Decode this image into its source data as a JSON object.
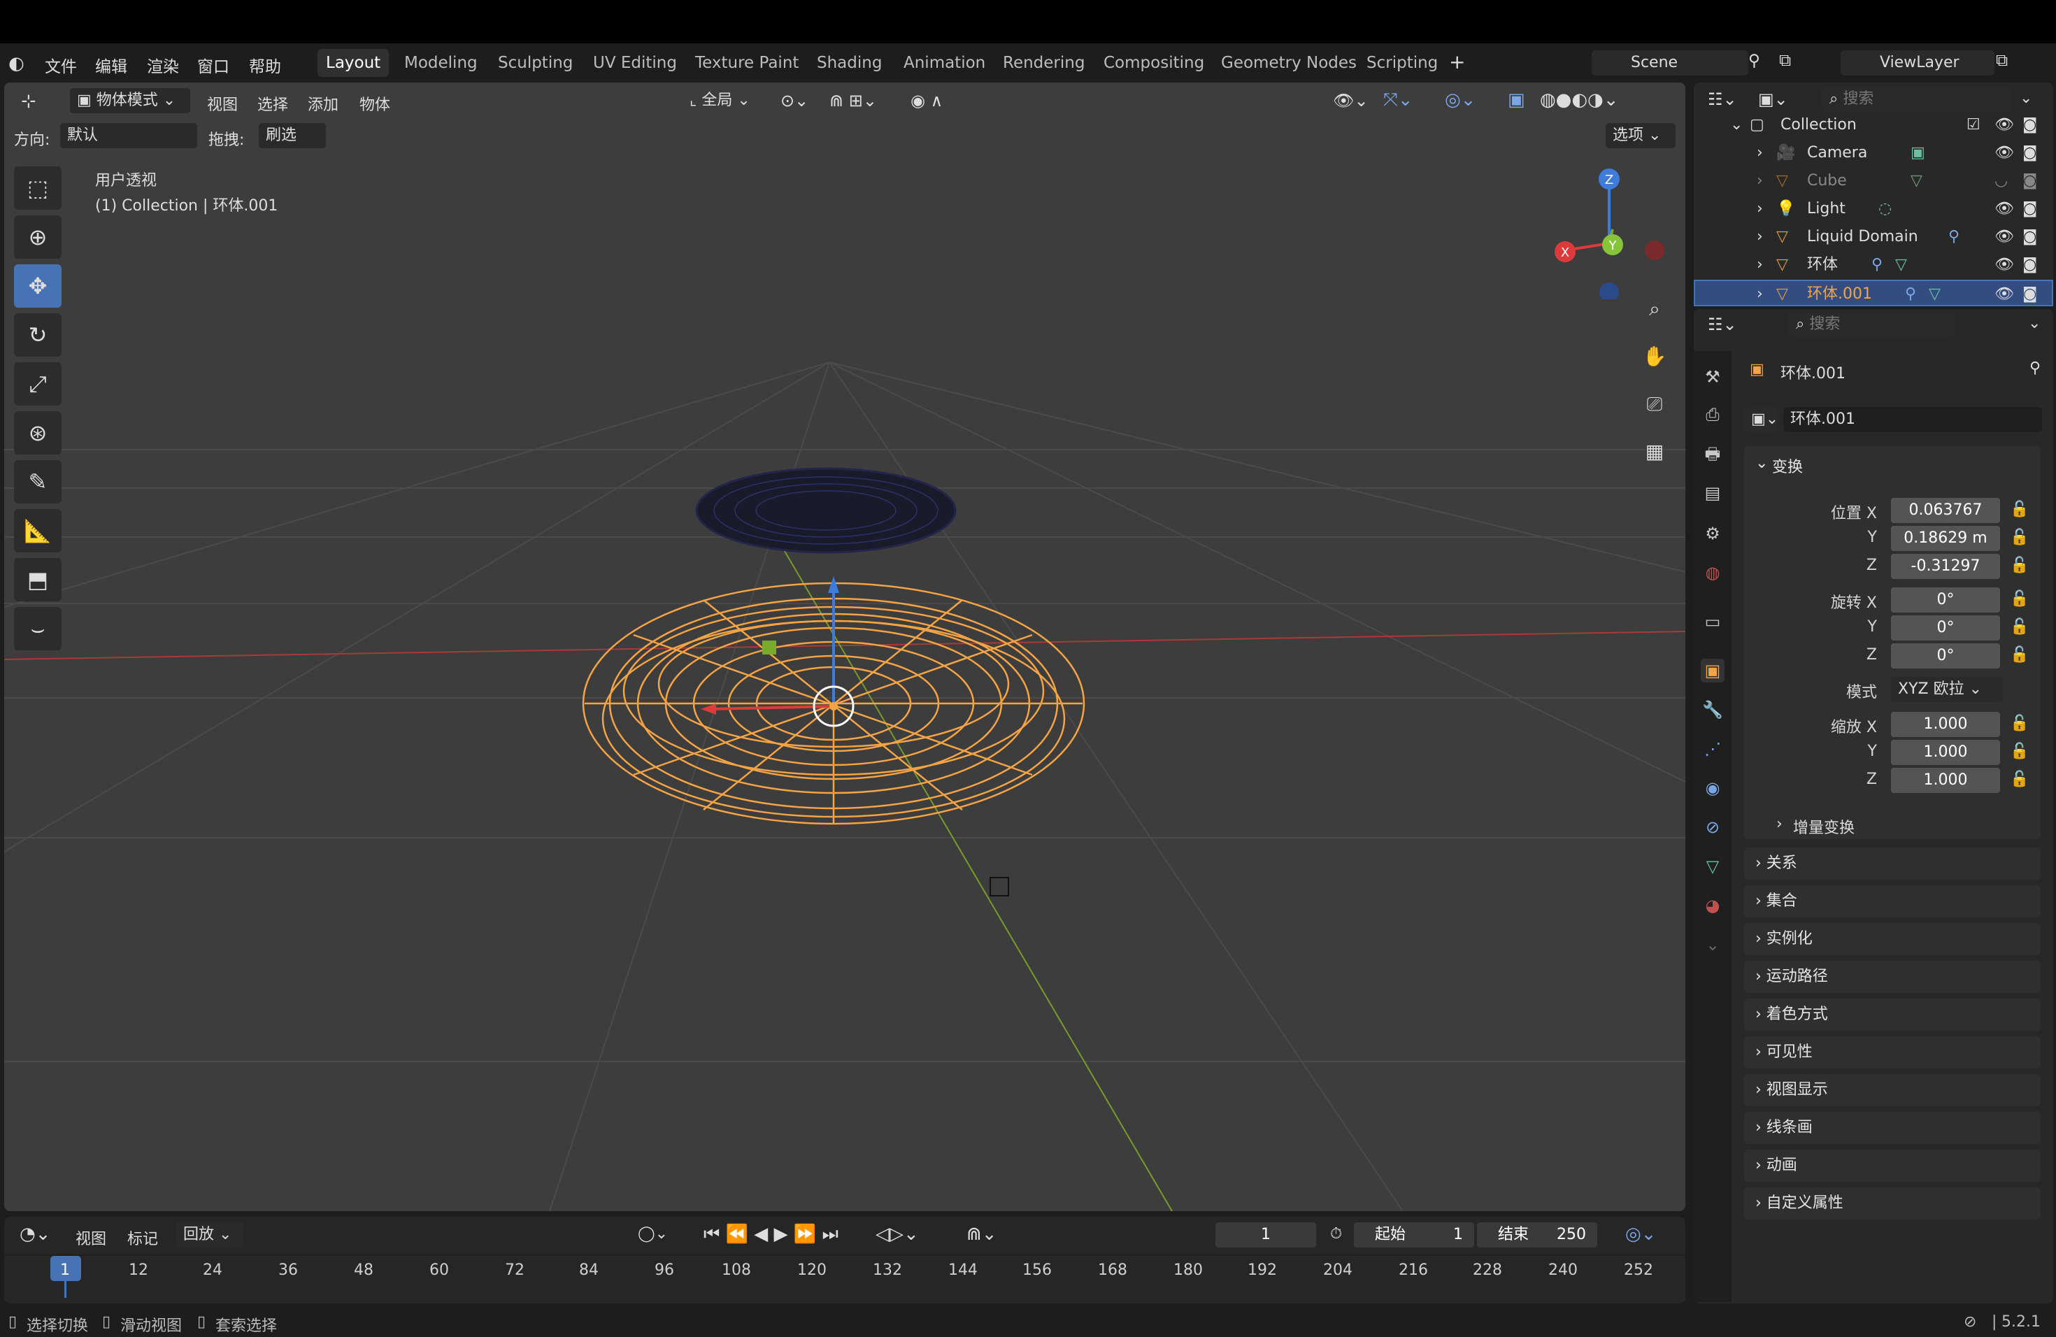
{
  "menu": {
    "items": [
      "文件",
      "编辑",
      "渲染",
      "窗口",
      "帮助"
    ]
  },
  "workspaces": [
    "Layout",
    "Modeling",
    "Sculpting",
    "UV Editing",
    "Texture Paint",
    "Shading",
    "Animation",
    "Rendering",
    "Compositing",
    "Geometry Nodes",
    "Scripting"
  ],
  "active_workspace": "Layout",
  "scene": {
    "name": "Scene",
    "viewlayer": "ViewLayer"
  },
  "viewport": {
    "mode": "物体模式",
    "menus": [
      "视图",
      "选择",
      "添加",
      "物体"
    ],
    "transform_orientation": "全局",
    "orientation_label": "方向:",
    "orientation_value": "默认",
    "drag_label": "拖拽:",
    "drag_value": "刷选",
    "options_label": "选项",
    "overlay_line1": "用户透视",
    "overlay_line2": "(1) Collection | 环体.001",
    "gizmo": {
      "x": "X",
      "y": "Y",
      "z": "Z"
    }
  },
  "outliner": {
    "search_placeholder": "搜索",
    "collection": "Collection",
    "items": [
      "Camera",
      "Cube",
      "Light",
      "Liquid Domain",
      "环体",
      "环体.001"
    ],
    "selected": "环体.001"
  },
  "properties": {
    "search_placeholder": "搜索",
    "object_name": "环体.001",
    "datablock_name": "环体.001",
    "transform_label": "变换",
    "location_label": "位置",
    "rotation_label": "旋转",
    "scale_label": "缩放",
    "mode_label": "模式",
    "mode_value": "XYZ 欧拉",
    "axis": {
      "x": "X",
      "y": "Y",
      "z": "Z"
    },
    "location": {
      "x": "0.063767",
      "y": "0.18629 m",
      "z": "-0.31297"
    },
    "rotation": {
      "x": "0°",
      "y": "0°",
      "z": "0°"
    },
    "scale": {
      "x": "1.000",
      "y": "1.000",
      "z": "1.000"
    },
    "delta_label": "增量变换",
    "panels": [
      "关系",
      "集合",
      "实例化",
      "运动路径",
      "着色方式",
      "可见性",
      "视图显示",
      "线条画",
      "动画",
      "自定义属性"
    ]
  },
  "timeline": {
    "menus": [
      "视图",
      "标记",
      "回放"
    ],
    "current_frame": "1",
    "start_label": "起始",
    "start_value": "1",
    "end_label": "结束",
    "end_value": "250",
    "ticks": [
      "1",
      "12",
      "24",
      "36",
      "48",
      "60",
      "72",
      "84",
      "96",
      "108",
      "120",
      "132",
      "144",
      "156",
      "168",
      "180",
      "192",
      "204",
      "216",
      "228",
      "240",
      "252"
    ]
  },
  "status": {
    "items": [
      "选择切换",
      "滑动视图",
      "套索选择"
    ],
    "version": "5.2.1"
  },
  "colors": {
    "accent": "#4772b3",
    "selected_orange": "#f5a445",
    "viewport_bg": "#3d3d3d"
  }
}
